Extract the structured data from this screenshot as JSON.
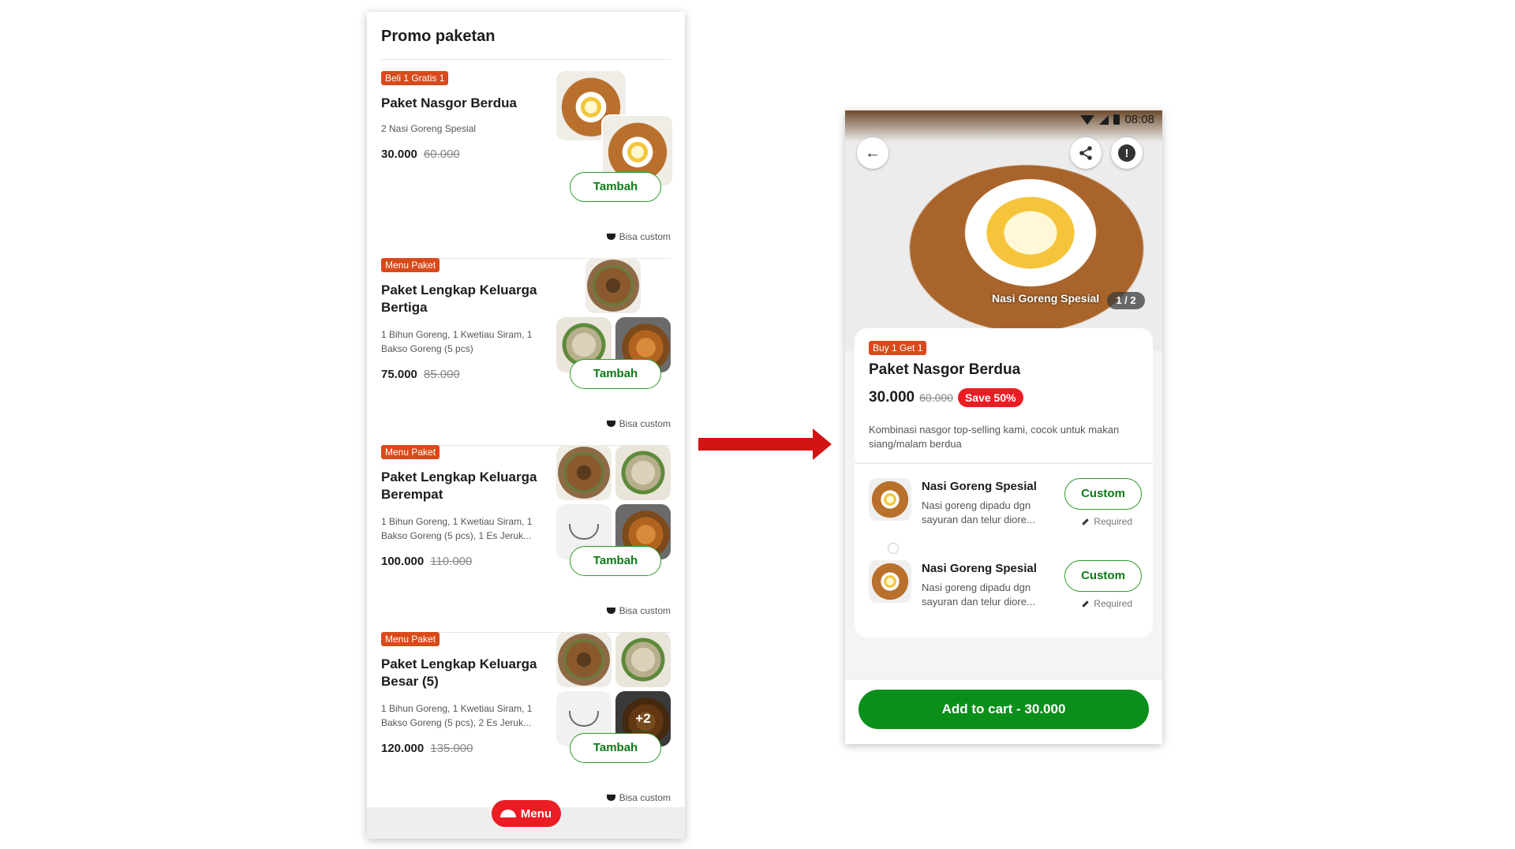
{
  "left": {
    "title": "Promo paketan",
    "items": [
      {
        "badge": "Beli 1 Gratis 1",
        "name": "Paket Nasgor Berdua",
        "desc": "2 Nasi Goreng Spesial",
        "price": "30.000",
        "old_price": "60.000",
        "button": "Tambah",
        "note": "Bisa custom"
      },
      {
        "badge": "Menu Paket",
        "name": "Paket Lengkap Keluarga Bertiga",
        "desc": "1 Bihun Goreng, 1 Kwetiau Siram, 1 Bakso Goreng (5 pcs)",
        "price": "75.000",
        "old_price": "85.000",
        "button": "Tambah",
        "note": "Bisa custom"
      },
      {
        "badge": "Menu Paket",
        "name": "Paket Lengkap Keluarga Berempat",
        "desc": "1 Bihun Goreng, 1 Kwetiau Siram, 1 Bakso Goreng (5 pcs), 1 Es Jeruk...",
        "price": "100.000",
        "old_price": "110.000",
        "button": "Tambah",
        "note": "Bisa custom"
      },
      {
        "badge": "Menu Paket",
        "name": "Paket Lengkap Keluarga Besar (5)",
        "desc": "1 Bihun Goreng, 1 Kwetiau Siram, 1 Bakso Goreng (5 pcs), 2 Es Jeruk...",
        "price": "120.000",
        "old_price": "135.000",
        "button": "Tambah",
        "note": "Bisa custom",
        "more": "+2"
      }
    ],
    "menu_button": "Menu"
  },
  "right": {
    "status_time": "08:08",
    "image_caption": "Nasi Goreng Spesial",
    "image_counter": "1 / 2",
    "badge": "Buy 1 Get 1",
    "title": "Paket Nasgor Berdua",
    "price": "30.000",
    "old_price": "60.000",
    "save": "Save 50%",
    "desc": "Kombinasi nasgor top-selling kami, cocok untuk makan siang/malam berdua",
    "sub_items": [
      {
        "name": "Nasi Goreng Spesial",
        "desc": "Nasi goreng dipadu dgn sayuran dan telur diore...",
        "button": "Custom",
        "required": "Required"
      },
      {
        "name": "Nasi Goreng Spesial",
        "desc": "Nasi goreng dipadu dgn sayuran dan telur diore...",
        "button": "Custom",
        "required": "Required"
      }
    ],
    "cart_button": "Add to cart - 30.000"
  },
  "colors": {
    "brand_green": "#0a8f1a",
    "promo_red": "#ec1c24",
    "badge_orange": "#d94a1a",
    "arrow_red": "#d21414"
  },
  "icons": [
    "back-arrow-icon",
    "share-icon",
    "info-icon",
    "wifi-icon",
    "signal-icon",
    "battery-icon",
    "cloche-icon",
    "pencil-icon",
    "bowl-icon"
  ]
}
